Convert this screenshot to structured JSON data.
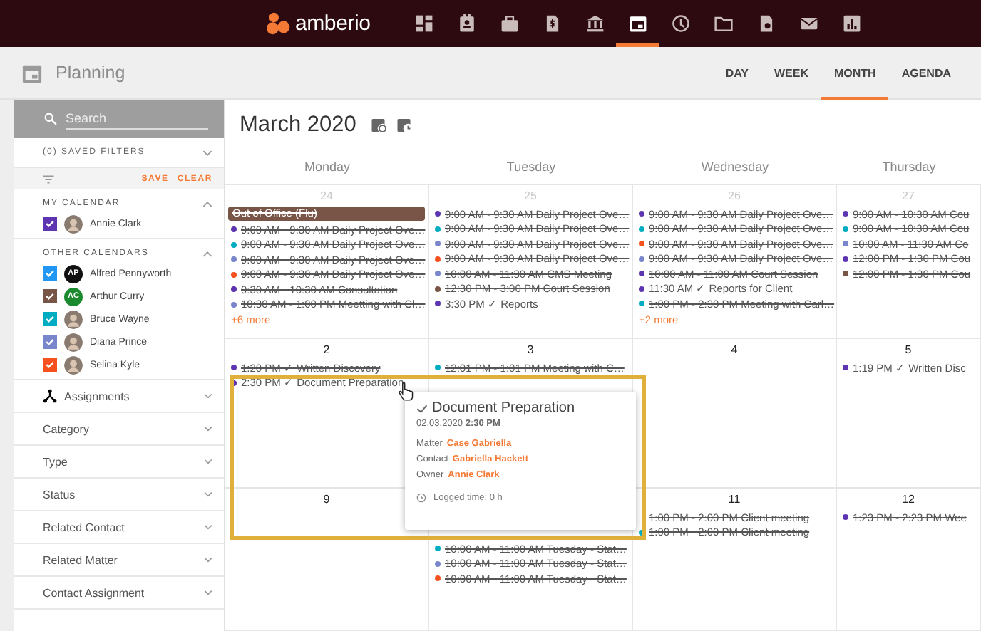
{
  "app": {
    "logo": "amberio"
  },
  "nav": [
    {
      "selected": false
    },
    {
      "selected": false
    },
    {
      "selected": false
    },
    {
      "selected": false
    },
    {
      "selected": false
    },
    {
      "selected": true
    },
    {
      "selected": false
    },
    {
      "selected": false
    },
    {
      "selected": false
    },
    {
      "selected": false
    },
    {
      "selected": false
    }
  ],
  "page": {
    "title": "Planning"
  },
  "views": [
    {
      "label": "DAY",
      "selected": false
    },
    {
      "label": "WEEK",
      "selected": false
    },
    {
      "label": "MONTH",
      "selected": true
    },
    {
      "label": "AGENDA",
      "selected": false
    }
  ],
  "sidebar": {
    "search": {
      "placeholder": "Search"
    },
    "saved_filters": "(0) SAVED FILTERS",
    "save": "SAVE",
    "clear": "CLEAR",
    "my_calendar": {
      "title": "MY CALENDAR",
      "items": [
        {
          "name": "Annie Clark",
          "checked": true,
          "color": "#5e35b1"
        }
      ]
    },
    "other_calendars": {
      "title": "OTHER CALENDARS",
      "items": [
        {
          "name": "Alfred Pennyworth",
          "checked": true,
          "color": "#2196f3",
          "avatar": {
            "initials": "AP",
            "color": "#111111"
          }
        },
        {
          "name": "Arthur Curry",
          "checked": true,
          "color": "#795548",
          "avatar": {
            "initials": "AC",
            "color": "#1b8a2e"
          }
        },
        {
          "name": "Bruce Wayne",
          "checked": true,
          "color": "#00acc1"
        },
        {
          "name": "Diana Prince",
          "checked": true,
          "color": "#7986cb"
        },
        {
          "name": "Selina Kyle",
          "checked": true,
          "color": "#f4511e"
        }
      ]
    },
    "filters": [
      {
        "label": "Assignments",
        "kind": "icon"
      },
      {
        "label": "Category",
        "kind": "plain"
      },
      {
        "label": "Type",
        "kind": "plain"
      },
      {
        "label": "Status",
        "kind": "plain"
      },
      {
        "label": "Related Contact",
        "kind": "plain"
      },
      {
        "label": "Related Matter",
        "kind": "plain"
      },
      {
        "label": "Contact Assignment",
        "kind": "plain"
      }
    ]
  },
  "calendar": {
    "title": "March 2020",
    "weekdays": [
      "Monday",
      "Tuesday",
      "Wednesday",
      "Thursday"
    ],
    "weeks": [
      [
        {
          "date": "24",
          "past": true,
          "events": [
            {
              "kind": "allday",
              "text": "Out of Office (Flu)",
              "done": true,
              "color": "#795548"
            },
            {
              "kind": "timed",
              "text": "9:00 AM - 9:30 AM Daily Project Ove…",
              "done": true,
              "color": "#5e35b1"
            },
            {
              "kind": "timed",
              "text": "9:00 AM - 9:30 AM Daily Project Ove…",
              "done": true,
              "color": "#00acc1"
            },
            {
              "kind": "timed",
              "text": "9:00 AM - 9:30 AM Daily Project Ove…",
              "done": true,
              "color": "#7986cb"
            },
            {
              "kind": "timed",
              "text": "9:00 AM - 9:30 AM Daily Project Ove…",
              "done": true,
              "color": "#f4511e"
            },
            {
              "kind": "timed",
              "text": "9:30 AM - 10:30 AM Consultation",
              "done": true,
              "color": "#5e35b1"
            },
            {
              "kind": "timed",
              "text": "10:30 AM - 1:00 PM Meetting with Cl…",
              "done": true,
              "color": "#7986cb"
            }
          ],
          "more": "+6 more"
        },
        {
          "date": "25",
          "past": true,
          "events": [
            {
              "kind": "timed",
              "text": "9:00 AM - 9:30 AM Daily Project Ove…",
              "done": true,
              "color": "#5e35b1"
            },
            {
              "kind": "timed",
              "text": "9:00 AM - 9:30 AM Daily Project Ove…",
              "done": true,
              "color": "#00acc1"
            },
            {
              "kind": "timed",
              "text": "9:00 AM - 9:30 AM Daily Project Ove…",
              "done": true,
              "color": "#7986cb"
            },
            {
              "kind": "timed",
              "text": "9:00 AM - 9:30 AM Daily Project Ove…",
              "done": true,
              "color": "#f4511e"
            },
            {
              "kind": "timed",
              "text": "10:00 AM - 11:30 AM CMS Meeting",
              "done": true,
              "color": "#7986cb"
            },
            {
              "kind": "timed",
              "text": "12:30 PM - 3:00 PM Court Session",
              "done": true,
              "color": "#795548"
            },
            {
              "kind": "timed",
              "text": "3:30 PM ✓ Reports",
              "done": false,
              "color": "#5e35b1"
            }
          ]
        },
        {
          "date": "26",
          "past": true,
          "events": [
            {
              "kind": "timed",
              "text": "9:00 AM - 9:30 AM Daily Project Ove…",
              "done": true,
              "color": "#5e35b1"
            },
            {
              "kind": "timed",
              "text": "9:00 AM - 9:30 AM Daily Project Ove…",
              "done": true,
              "color": "#00acc1"
            },
            {
              "kind": "timed",
              "text": "9:00 AM - 9:30 AM Daily Project Ove…",
              "done": true,
              "color": "#f4511e"
            },
            {
              "kind": "timed",
              "text": "9:00 AM - 9:30 AM Daily Project Ove…",
              "done": true,
              "color": "#7986cb"
            },
            {
              "kind": "timed",
              "text": "10:00 AM - 11:00 AM Court Session",
              "done": true,
              "color": "#5e35b1"
            },
            {
              "kind": "timed",
              "text": "11:30 AM ✓ Reports for Client",
              "done": false,
              "color": "#5e35b1"
            },
            {
              "kind": "timed",
              "text": "1:00 PM - 2:30 PM Meeting with Carl…",
              "done": true,
              "color": "#00acc1"
            }
          ],
          "more": "+2 more"
        },
        {
          "date": "27",
          "past": true,
          "events": [
            {
              "kind": "timed",
              "text": "9:00 AM - 10:30 AM Cou",
              "done": true,
              "color": "#5e35b1"
            },
            {
              "kind": "timed",
              "text": "9:00 AM - 10:30 AM Cou",
              "done": true,
              "color": "#00acc1"
            },
            {
              "kind": "timed",
              "text": "10:00 AM - 11:30 AM Co",
              "done": true,
              "color": "#7986cb"
            },
            {
              "kind": "timed",
              "text": "12:00 PM - 1:30 PM Cou",
              "done": true,
              "color": "#5e35b1"
            },
            {
              "kind": "timed",
              "text": "12:00 PM - 1:30 PM Cou",
              "done": true,
              "color": "#795548"
            }
          ]
        }
      ],
      [
        {
          "date": "2",
          "past": false,
          "events": [
            {
              "kind": "timed",
              "text": "1:20 PM ✓ Written Discovery",
              "done": true,
              "color": "#5e35b1"
            },
            {
              "kind": "timed",
              "text": "2:30 PM ✓ Document Preparation",
              "done": false,
              "color": "#5e35b1"
            }
          ]
        },
        {
          "date": "3",
          "past": false,
          "events": [
            {
              "kind": "timed",
              "text": "12:01 PM - 1:01 PM Meeting with C…",
              "done": true,
              "color": "#00acc1"
            }
          ]
        },
        {
          "date": "4",
          "past": false
        },
        {
          "date": "5",
          "past": false,
          "events": [
            {
              "kind": "timed",
              "text": "1:19 PM ✓ Written Disc",
              "done": false,
              "color": "#5e35b1"
            }
          ]
        }
      ],
      [
        {
          "date": "9",
          "past": false
        },
        {
          "events": [
            {
              "kind": "timed",
              "text": "10:00 AM - 11:00 AM Tuesday - Stat…",
              "done": true,
              "color": "#00acc1"
            },
            {
              "kind": "timed",
              "text": "10:00 AM - 11:00 AM Tuesday - Stat…",
              "done": true,
              "color": "#7986cb"
            },
            {
              "kind": "timed",
              "text": "10:00 AM - 11:00 AM Tuesday - Stat…",
              "done": true,
              "color": "#f4511e"
            }
          ]
        },
        {
          "date": "11",
          "past": false,
          "events": [
            {
              "kind": "timed",
              "text": "1:00 PM - 2:00 PM Client meeting",
              "done": true
            },
            {
              "kind": "timed",
              "text": "1:00 PM - 2:00 PM Client meeting",
              "done": true,
              "color": "#00acc1"
            }
          ]
        },
        {
          "date": "12",
          "past": false,
          "events": [
            {
              "kind": "timed",
              "text": "1:23 PM - 2:23 PM Wee",
              "done": true,
              "color": "#5e35b1"
            }
          ]
        }
      ]
    ]
  },
  "popup": {
    "title": "Document Preparation",
    "when": "02.03.2020 **2:30 PM**",
    "fields": [
      {
        "label": "Matter",
        "value": "Case Gabriella"
      },
      {
        "label": "Contact",
        "value": "Gabriella Hackett"
      },
      {
        "label": "Owner",
        "value": "Annie Clark"
      }
    ],
    "logged": "Logged time: 0 h"
  }
}
